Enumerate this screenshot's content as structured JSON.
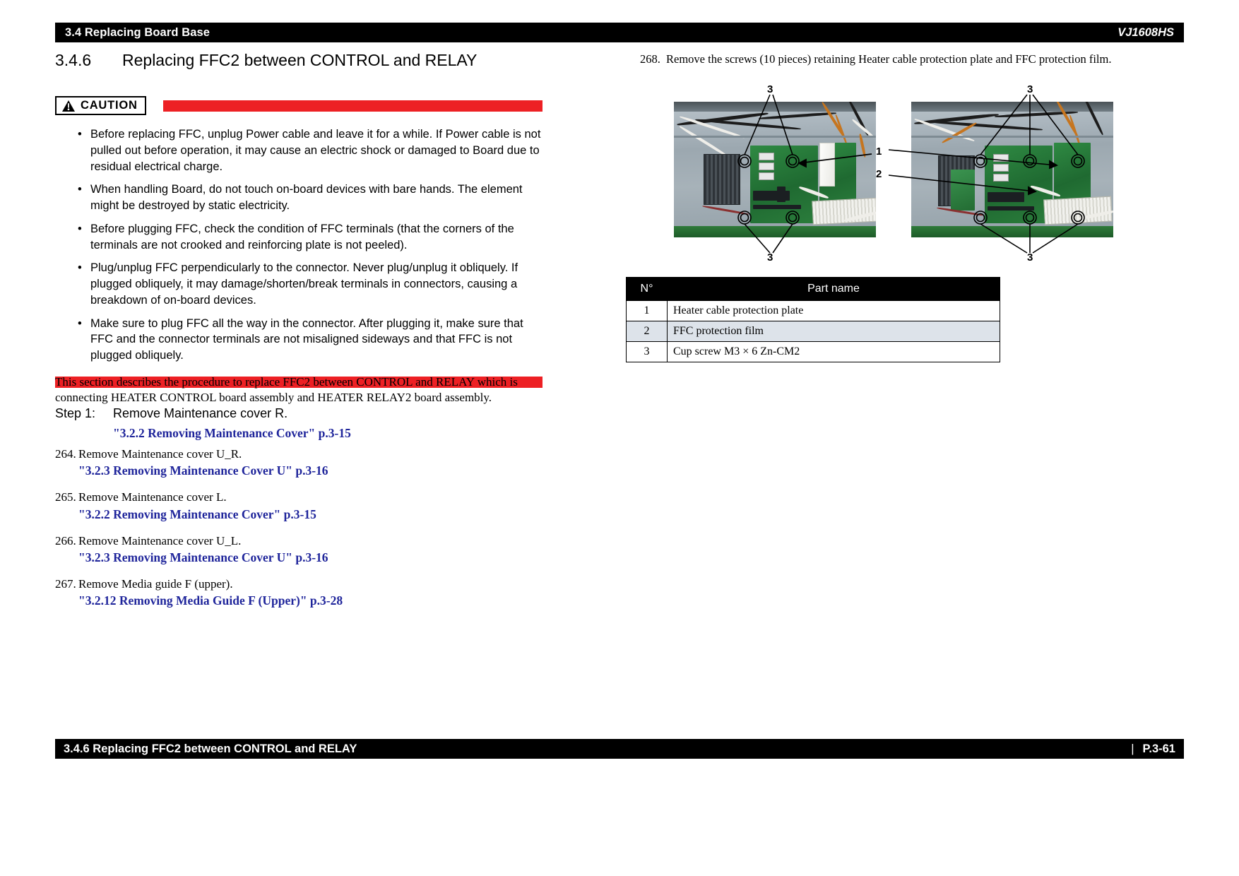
{
  "header": {
    "left_title": "3.4 Replacing Board Base",
    "right_model": "VJ1608HS"
  },
  "section": {
    "number": "3.4.6",
    "title": "Replacing FFC2 between CONTROL and RELAY"
  },
  "caution": {
    "label": "CAUTION",
    "icon": "warning-triangle-icon",
    "rule_color": "#ed2024",
    "bullets": [
      "Before replacing FFC, unplug Power cable and leave it for a while. If Power cable is not pulled out before operation, it may cause an electric shock or damaged to Board due to residual electrical charge.",
      "When handling Board, do not touch on-board devices with bare hands. The element might be destroyed by static electricity.",
      "Before plugging FFC, check the condition of FFC terminals (that the corners of the terminals are not crooked and reinforcing plate is not peeled).",
      "Plug/unplug FFC perpendicularly to the connector.  Never plug/unplug it obliquely. If plugged obliquely, it may damage/shorten/break terminals in connectors, causing a breakdown of on-board devices.",
      "Make sure to plug FFC all the way in the connector. After plugging it, make sure that FFC and the connector terminals are not misaligned sideways and that FFC is not plugged obliquely."
    ]
  },
  "intro": "This section describes the procedure to replace FFC2 between CONTROL and RELAY which is connecting HEATER CONTROL board assembly and HEATER RELAY2 board assembly.",
  "step": {
    "label": "Step 1:",
    "text": "Remove Maintenance cover R.",
    "reference": "\"3.2.2 Removing Maintenance Cover\" p.3-15"
  },
  "procedures": [
    {
      "number": "264.",
      "text": "Remove Maintenance cover U_R.",
      "reference": "\"3.2.3 Removing Maintenance Cover U\" p.3-16"
    },
    {
      "number": "265.",
      "text": "Remove Maintenance cover L.",
      "reference": "\"3.2.2 Removing Maintenance Cover\" p.3-15"
    },
    {
      "number": "266.",
      "text": "Remove Maintenance cover U_L.",
      "reference": "\"3.2.3 Removing Maintenance Cover U\" p.3-16"
    },
    {
      "number": "267.",
      "text": "Remove Media guide F (upper).",
      "reference": "\"3.2.12 Removing Media Guide F (Upper)\" p.3-28"
    }
  ],
  "right_step": {
    "number": "268.",
    "text": "Remove the screws (10 pieces) retaining Heater cable protection plate and FFC protection film."
  },
  "figure": {
    "callouts": {
      "top_left": "3",
      "top_right": "3",
      "bottom_left": "3",
      "bottom_right": "3",
      "mid_upper": "1",
      "mid_lower": "2"
    }
  },
  "parts_table": {
    "columns": [
      "N°",
      "Part name"
    ],
    "rows": [
      {
        "no": "1",
        "name": "Heater cable protection plate"
      },
      {
        "no": "2",
        "name": "FFC protection film"
      },
      {
        "no": "3",
        "name": "Cup screw M3 × 6 Zn-CM2"
      }
    ]
  },
  "footer": {
    "left_title": "3.4.6 Replacing FFC2 between CONTROL and RELAY",
    "separator": "|",
    "page": "P.3-61"
  }
}
